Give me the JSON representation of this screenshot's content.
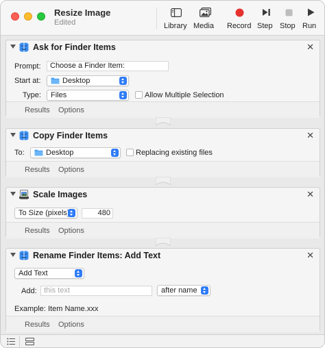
{
  "window": {
    "title": "Resize Image",
    "subtitle": "Edited"
  },
  "toolbar": {
    "library": "Library",
    "media": "Media",
    "record": "Record",
    "step": "Step",
    "stop": "Stop",
    "run": "Run"
  },
  "actions": {
    "ask": {
      "title": "Ask for Finder Items",
      "prompt_label": "Prompt:",
      "prompt_value": "Choose a Finder Item:",
      "start_label": "Start at:",
      "start_value": "Desktop",
      "type_label": "Type:",
      "type_value": "Files",
      "allow_multiple": "Allow Multiple Selection",
      "results": "Results",
      "options": "Options"
    },
    "copy": {
      "title": "Copy Finder Items",
      "to_label": "To:",
      "to_value": "Desktop",
      "replacing": "Replacing existing files",
      "results": "Results",
      "options": "Options"
    },
    "scale": {
      "title": "Scale Images",
      "mode_value": "To Size (pixels)",
      "size_value": "480",
      "results": "Results",
      "options": "Options"
    },
    "rename": {
      "title": "Rename Finder Items: Add Text",
      "mode_value": "Add Text",
      "add_label": "Add:",
      "add_placeholder": "this text",
      "position_value": "after name",
      "example_label": "Example:",
      "example_value": "Item Name.xxx",
      "results": "Results",
      "options": "Options"
    }
  },
  "colors": {
    "record": "#e5322d",
    "accent": "#2f7cf6"
  }
}
